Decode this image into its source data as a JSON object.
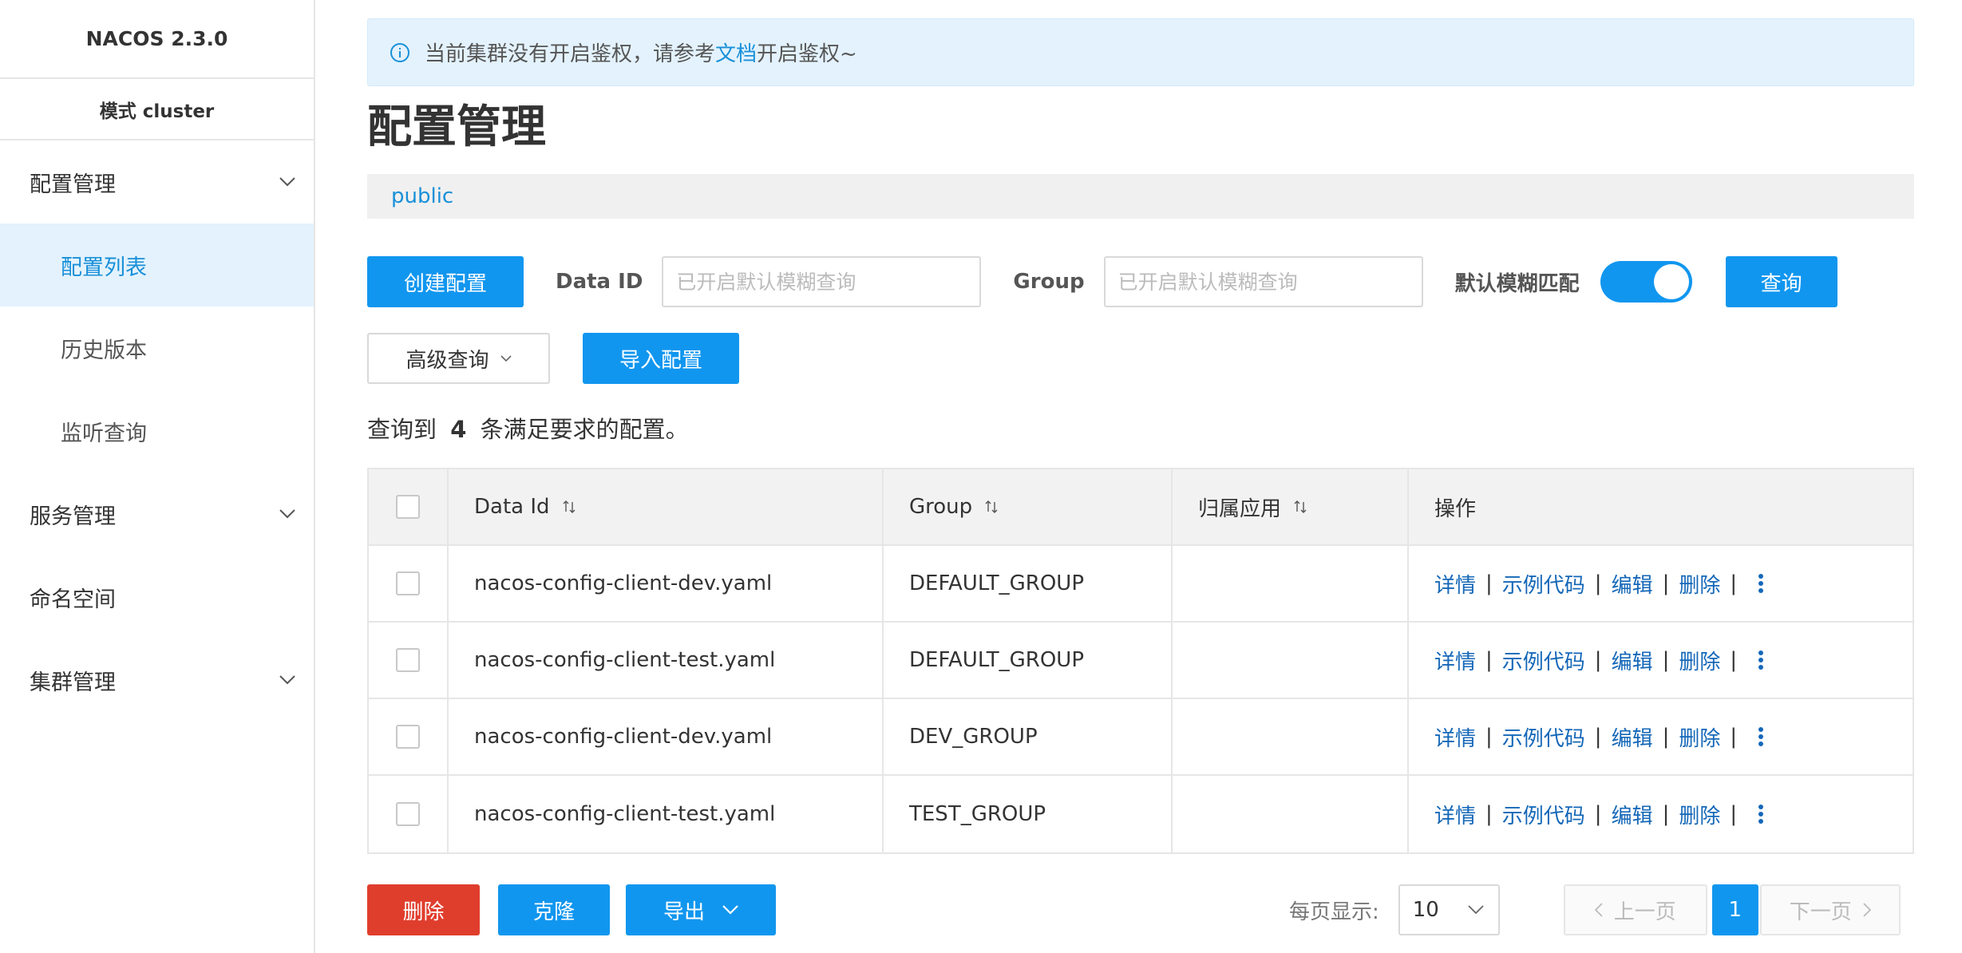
{
  "sidebar": {
    "brand": "NACOS 2.3.0",
    "mode": "模式 cluster",
    "groups": [
      {
        "label": "配置管理",
        "items": [
          "配置列表",
          "历史版本",
          "监听查询"
        ]
      },
      {
        "label": "服务管理"
      },
      {
        "label": "命名空间"
      },
      {
        "label": "集群管理"
      }
    ],
    "active_item": "配置列表"
  },
  "notice": {
    "before": "当前集群没有开启鉴权，请参考",
    "link": "文档",
    "after": "开启鉴权~"
  },
  "page": {
    "title": "配置管理",
    "namespace": "public"
  },
  "toolbar": {
    "create_label": "创建配置",
    "data_id_label": "Data ID",
    "data_id_placeholder": "已开启默认模糊查询",
    "group_label": "Group",
    "group_placeholder": "已开启默认模糊查询",
    "fuzzy_label": "默认模糊匹配",
    "fuzzy_enabled": true,
    "query_label": "查询",
    "advanced_label": "高级查询",
    "import_label": "导入配置"
  },
  "result": {
    "prefix": "查询到",
    "count": "4",
    "suffix": "条满足要求的配置。"
  },
  "table": {
    "columns": [
      "Data Id",
      "Group",
      "归属应用",
      "操作"
    ],
    "rows": [
      {
        "data_id": "nacos-config-client-dev.yaml",
        "group": "DEFAULT_GROUP",
        "app": ""
      },
      {
        "data_id": "nacos-config-client-test.yaml",
        "group": "DEFAULT_GROUP",
        "app": ""
      },
      {
        "data_id": "nacos-config-client-dev.yaml",
        "group": "DEV_GROUP",
        "app": ""
      },
      {
        "data_id": "nacos-config-client-test.yaml",
        "group": "TEST_GROUP",
        "app": ""
      }
    ],
    "actions": {
      "detail": "详情",
      "sample": "示例代码",
      "edit": "编辑",
      "delete": "删除",
      "separator": "|"
    }
  },
  "footer": {
    "delete_label": "删除",
    "clone_label": "克隆",
    "export_label": "导出",
    "page_size_label": "每页显示:",
    "page_size": "10",
    "prev_label": "上一页",
    "current_page": "1",
    "next_label": "下一页"
  },
  "colors": {
    "primary": "#1196ef",
    "danger": "#e03e2d",
    "link": "#1467b8",
    "notice_bg": "#e3f2fd"
  }
}
